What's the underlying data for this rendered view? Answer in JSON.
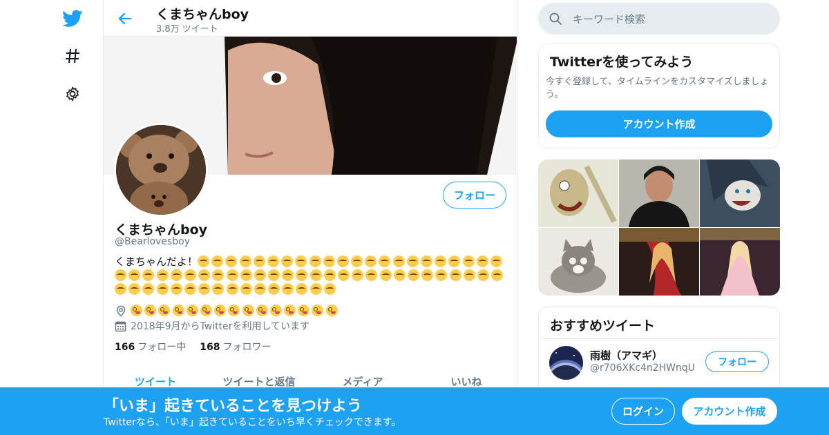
{
  "header": {
    "title": "くまちゃんboy",
    "tweet_count": "3.8万 ツイート"
  },
  "profile": {
    "name": "くまちゃんboy",
    "handle": "@Bearlovesboy",
    "bio_text": "くまちゃんだよ！",
    "bio_emoji_count": 66,
    "location_emoji_count": 15,
    "joined": "2018年9月からTwitterを利用しています",
    "following_count": "166",
    "following_label": "フォロー中",
    "followers_count": "168",
    "followers_label": "フォロワー",
    "follow_label": "フォロー"
  },
  "tabs": [
    {
      "label": "ツイート"
    },
    {
      "label": "ツイートと返信"
    },
    {
      "label": "メディア"
    },
    {
      "label": "いいね"
    }
  ],
  "search": {
    "placeholder": "キーワード検索"
  },
  "try_card": {
    "title": "Twitterを使ってみよう",
    "description": "今すぐ登録して、タイムラインをカスタマイズしましょう。",
    "button": "アカウント作成"
  },
  "recommended": {
    "title": "おすすめツイート",
    "user_name": "雨樹（アマギ）",
    "user_handle": "@r706XKc4n2HWnqU",
    "follow_label": "フォロー"
  },
  "bottom_bar": {
    "title": "「いま」起きていることを見つけよう",
    "subtitle": "Twitterなら、「いま」起きていることをいち早くチェックできます。",
    "login": "ログイン",
    "signup": "アカウント作成"
  },
  "colors": {
    "accent": "#1da1f2",
    "text": "#14171a",
    "muted": "#657786",
    "border": "#e6ecf0"
  },
  "icons": {
    "logo": "twitter-bird-icon",
    "explore": "hashtag-icon",
    "settings": "gear-icon",
    "back": "arrow-left-icon",
    "search": "search-icon",
    "location": "location-pin-icon",
    "calendar": "calendar-icon"
  }
}
